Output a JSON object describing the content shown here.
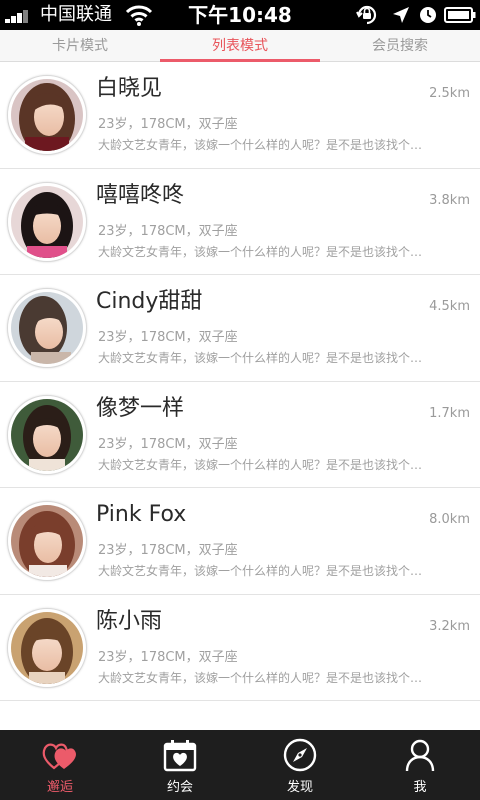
{
  "status_bar": {
    "carrier": "中国联通",
    "time": "下午10:48"
  },
  "tabs": [
    {
      "label": "卡片模式",
      "active": false
    },
    {
      "label": "列表模式",
      "active": true
    },
    {
      "label": "会员搜索",
      "active": false
    }
  ],
  "users": [
    {
      "name": "白晓见",
      "distance": "2.5km",
      "meta": "23岁，178CM，双子座",
      "description": "大龄文艺女青年，该嫁一个什么样的人呢？是不是也该找个…"
    },
    {
      "name": "嘻嘻咚咚",
      "distance": "3.8km",
      "meta": "23岁，178CM，双子座",
      "description": "大龄文艺女青年，该嫁一个什么样的人呢？是不是也该找个…"
    },
    {
      "name": "Cindy甜甜",
      "distance": "4.5km",
      "meta": "23岁，178CM，双子座",
      "description": "大龄文艺女青年，该嫁一个什么样的人呢？是不是也该找个…"
    },
    {
      "name": "像梦一样",
      "distance": "1.7km",
      "meta": "23岁，178CM，双子座",
      "description": "大龄文艺女青年，该嫁一个什么样的人呢？是不是也该找个…"
    },
    {
      "name": "Pink Fox",
      "distance": "8.0km",
      "meta": "23岁，178CM，双子座",
      "description": "大龄文艺女青年，该嫁一个什么样的人呢？是不是也该找个…"
    },
    {
      "name": "陈小雨",
      "distance": "3.2km",
      "meta": "23岁，178CM，双子座",
      "description": "大龄文艺女青年，该嫁一个什么样的人呢？是不是也该找个…"
    }
  ],
  "bottom_nav": [
    {
      "label": "邂逅",
      "icon": "hearts-icon",
      "active": true
    },
    {
      "label": "约会",
      "icon": "calendar-heart-icon",
      "active": false
    },
    {
      "label": "发现",
      "icon": "compass-icon",
      "active": false
    },
    {
      "label": "我",
      "icon": "user-icon",
      "active": false
    }
  ],
  "colors": {
    "accent": "#ec5b6a",
    "nav_bg": "#1e1e1e",
    "text_secondary": "#a0a0a0"
  }
}
